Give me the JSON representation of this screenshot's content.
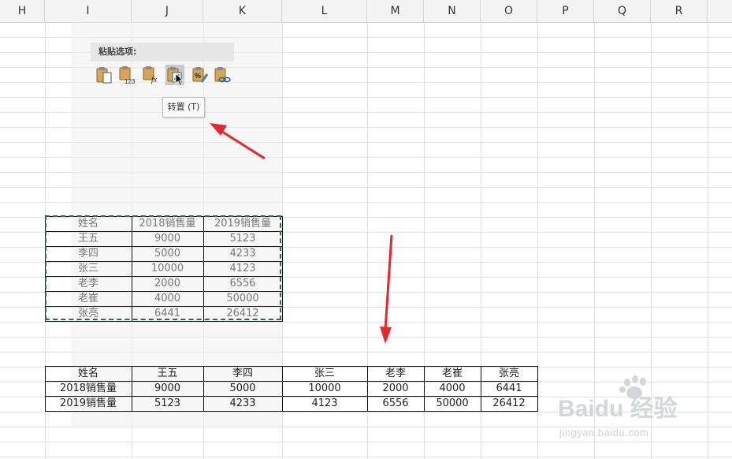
{
  "columns": [
    "H",
    "I",
    "J",
    "K",
    "L",
    "M",
    "N",
    "O",
    "P",
    "Q",
    "R"
  ],
  "paste_options": {
    "title": "粘贴选项:",
    "buttons": [
      "paste-icon",
      "paste-values-icon",
      "paste-formulas-icon",
      "transpose-icon",
      "paste-formatting-icon",
      "paste-link-icon"
    ],
    "button_text": {
      "values": "123",
      "formulas": "fx"
    },
    "tooltip": "转置 (T)"
  },
  "source_table": {
    "headers": [
      "姓名",
      "2018销售量",
      "2019销售量"
    ],
    "rows": [
      [
        "王五",
        "9000",
        "5123"
      ],
      [
        "李四",
        "5000",
        "4233"
      ],
      [
        "张三",
        "10000",
        "4123"
      ],
      [
        "老李",
        "2000",
        "6556"
      ],
      [
        "老崔",
        "4000",
        "50000"
      ],
      [
        "张亮",
        "6441",
        "26412"
      ]
    ]
  },
  "transposed_table": {
    "rows": [
      [
        "姓名",
        "王五",
        "李四",
        "张三",
        "老李",
        "老崔",
        "张亮"
      ],
      [
        "2018销售量",
        "9000",
        "5000",
        "10000",
        "2000",
        "4000",
        "6441"
      ],
      [
        "2019销售量",
        "5123",
        "4233",
        "4123",
        "6556",
        "50000",
        "26412"
      ]
    ]
  },
  "annotations": {
    "arrow_color": "#e8262b"
  },
  "watermark": {
    "logo": "Baidu 经验",
    "url": "jingyan.baidu.com"
  },
  "colors": {
    "selection_border": "#2e6b46",
    "grid": "#e2e2e2"
  }
}
